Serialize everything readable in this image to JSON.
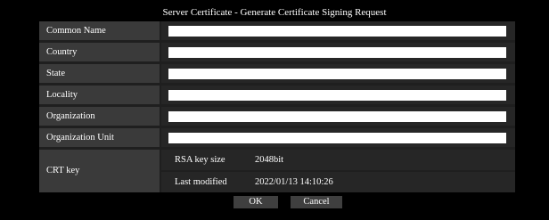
{
  "title": "Server Certificate - Generate Certificate Signing Request",
  "fields": [
    {
      "label": "Common Name",
      "value": ""
    },
    {
      "label": "Country",
      "value": ""
    },
    {
      "label": "State",
      "value": ""
    },
    {
      "label": "Locality",
      "value": ""
    },
    {
      "label": "Organization",
      "value": ""
    },
    {
      "label": "Organization Unit",
      "value": ""
    }
  ],
  "crt_key": {
    "label": "CRT key",
    "rsa_key_size_label": "RSA key size",
    "rsa_key_size_value": "2048bit",
    "last_modified_label": "Last modified",
    "last_modified_value": "2022/01/13 14:10:26"
  },
  "buttons": {
    "ok": "OK",
    "cancel": "Cancel"
  },
  "colors": {
    "background": "#000000",
    "label_cell": "#3a3a3a",
    "value_cell": "#262626",
    "input": "#ffffff",
    "button": "#3f3f3f"
  }
}
